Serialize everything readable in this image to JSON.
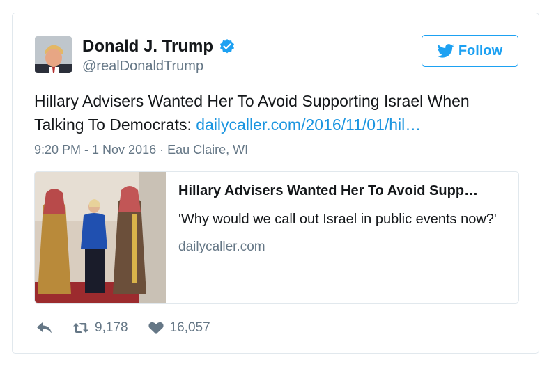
{
  "author": {
    "name": "Donald J. Trump",
    "handle": "@realDonaldTrump"
  },
  "follow_label": "Follow",
  "tweet": {
    "text": "Hillary Advisers Wanted Her To Avoid Supporting Israel When Talking To Democrats: ",
    "link": "dailycaller.com/2016/11/01/hil…",
    "meta": "9:20 PM - 1 Nov 2016 · Eau Claire, WI"
  },
  "card": {
    "title": "Hillary Advisers Wanted Her To Avoid Supp…",
    "description": "'Why would we call out Israel in public events now?'",
    "domain": "dailycaller.com"
  },
  "actions": {
    "retweets": "9,178",
    "likes": "16,057"
  },
  "colors": {
    "accent": "#1da1f2",
    "link": "#1b95e0",
    "muted": "#657786"
  },
  "icons": [
    "verified-badge-icon",
    "twitter-bird-icon",
    "reply-icon",
    "retweet-icon",
    "heart-icon"
  ]
}
